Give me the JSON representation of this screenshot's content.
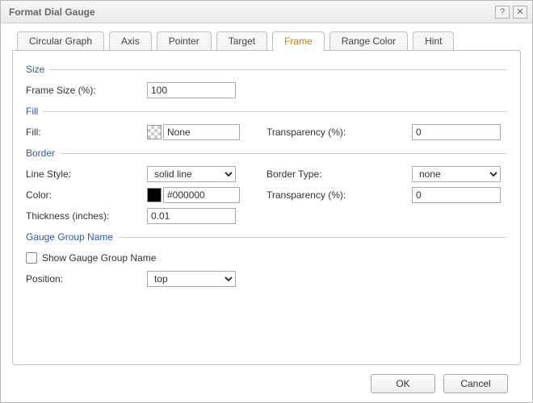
{
  "window": {
    "title": "Format Dial Gauge"
  },
  "tabs": [
    "Circular Graph",
    "Axis",
    "Pointer",
    "Target",
    "Frame",
    "Range Color",
    "Hint"
  ],
  "activeTabIndex": 4,
  "sections": {
    "size": {
      "legend": "Size",
      "frameSizeLabel": "Frame Size (%):",
      "frameSizeValue": "100"
    },
    "fill": {
      "legend": "Fill",
      "fillLabel": "Fill:",
      "fillValue": "None",
      "transparencyLabel": "Transparency (%):",
      "transparencyValue": "0"
    },
    "border": {
      "legend": "Border",
      "lineStyleLabel": "Line Style:",
      "lineStyleValue": "solid line",
      "borderTypeLabel": "Border Type:",
      "borderTypeValue": "none",
      "colorLabel": "Color:",
      "colorValue": "#000000",
      "transparencyLabel": "Transparency (%):",
      "transparencyValue": "0",
      "thicknessLabel": "Thickness (inches):",
      "thicknessValue": "0.01"
    },
    "gaugeGroup": {
      "legend": "Gauge Group Name",
      "showLabel": "Show Gauge Group Name",
      "positionLabel": "Position:",
      "positionValue": "top"
    }
  },
  "buttons": {
    "ok": "OK",
    "cancel": "Cancel"
  }
}
